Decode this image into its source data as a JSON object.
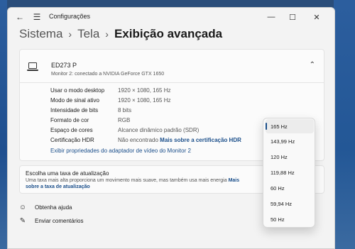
{
  "window": {
    "app_title": "Configurações"
  },
  "breadcrumb": {
    "items": [
      "Sistema",
      "Tela",
      "Exibição avançada"
    ]
  },
  "monitor": {
    "name": "ED273 P",
    "subtitle": "Monitor 2: conectado a NVIDIA GeForce GTX 1650"
  },
  "details": {
    "rows": [
      {
        "label": "Usar o modo desktop",
        "value": "1920 × 1080, 165 Hz"
      },
      {
        "label": "Modo de sinal ativo",
        "value": "1920 × 1080, 165 Hz"
      },
      {
        "label": "Intensidade de bits",
        "value": "8 bits"
      },
      {
        "label": "Formato de cor",
        "value": "RGB"
      },
      {
        "label": "Espaço de cores",
        "value": "Alcance dinâmico padrão (SDR)"
      },
      {
        "label": "Certificação HDR",
        "value": "Não encontrado",
        "link": "Mais sobre a certificação HDR"
      }
    ],
    "adapter_link": "Exibir propriedades do adaptador de vídeo do Monitor 2"
  },
  "refresh": {
    "title": "Escolha uma taxa de atualização",
    "description": "Uma taxa mais alta proporciona um movimento mais suave, mas também usa mais energia",
    "link": "Mais sobre a taxa de atualização"
  },
  "help": {
    "get_help": "Obtenha ajuda",
    "feedback": "Enviar comentários"
  },
  "dropdown": {
    "selected": "165 Hz",
    "options": [
      "165 Hz",
      "143,99 Hz",
      "120 Hz",
      "119,88 Hz",
      "60 Hz",
      "59,94 Hz",
      "50 Hz"
    ]
  }
}
